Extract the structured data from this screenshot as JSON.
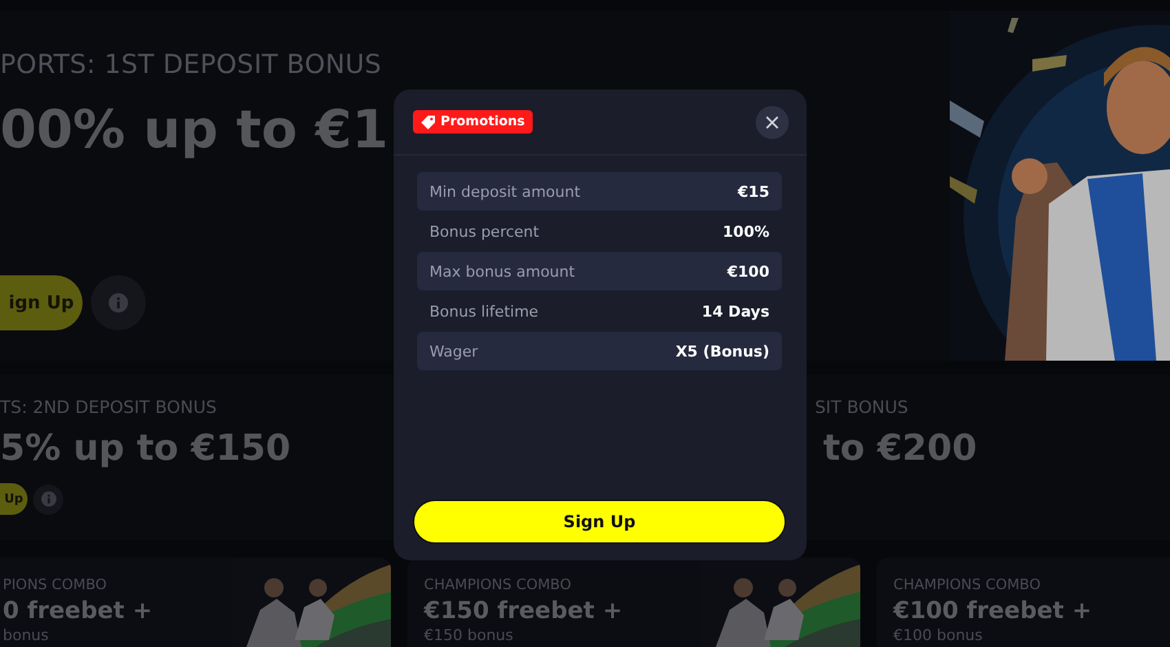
{
  "hero": {
    "subtitle": "PORTS: 1ST DEPOSIT BONUS",
    "headline": "00% up to €1",
    "button": "ign Up"
  },
  "deposit_cards": [
    {
      "kind": "full",
      "subtitle": "TS: 2ND DEPOSIT BONUS",
      "headline": "5% up to €150",
      "button": "Up"
    },
    {
      "kind": "partial",
      "subtitle": "SIT BONUS",
      "headline": "to €200"
    }
  ],
  "combo_cards": [
    {
      "subtitle": "PIONS COMBO",
      "headline": "0 freebet +",
      "bonus": "bonus"
    },
    {
      "subtitle": "CHAMPIONS COMBO",
      "headline": "€150 freebet +",
      "bonus": "€150 bonus"
    },
    {
      "subtitle": "CHAMPIONS COMBO",
      "headline": "€100 freebet +",
      "bonus": "€100 bonus"
    }
  ],
  "modal": {
    "badge": "Promotions",
    "rows": [
      {
        "label": "Min deposit amount",
        "value": "€15",
        "shaded": true
      },
      {
        "label": "Bonus percent",
        "value": "100%",
        "shaded": false
      },
      {
        "label": "Max bonus amount",
        "value": "€100",
        "shaded": true
      },
      {
        "label": "Bonus lifetime",
        "value": "14 Days",
        "shaded": false
      },
      {
        "label": "Wager",
        "value": "X5 (Bonus)",
        "shaded": true
      }
    ],
    "button": "Sign Up"
  }
}
